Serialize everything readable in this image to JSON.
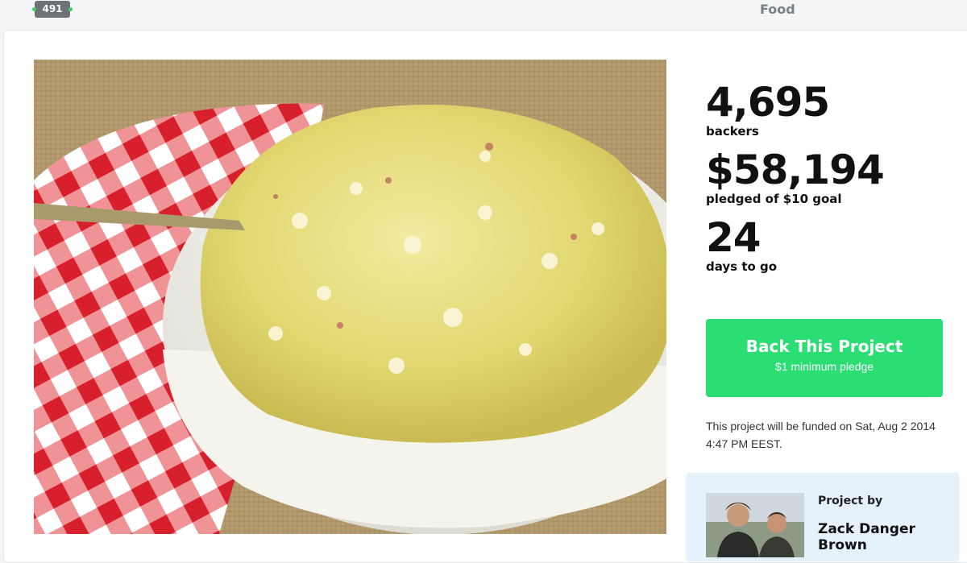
{
  "header": {
    "badge_count": "491",
    "category": "Food"
  },
  "project": {
    "image_alt": "Bowl of potato salad on a red checkered napkin"
  },
  "stats": {
    "backers_count": "4,695",
    "backers_label": "backers",
    "pledged_amount": "$58,194",
    "pledged_label": "pledged of $10 goal",
    "days_count": "24",
    "days_label": "days to go"
  },
  "back_button": {
    "label": "Back This Project",
    "sublabel": "$1 minimum pledge"
  },
  "funding_note": "This project will be funded on Sat, Aug 2 2014 4:47 PM EEST.",
  "creator": {
    "project_by_label": "Project by",
    "name": "Zack Danger Brown"
  },
  "colors": {
    "accent_green": "#2bde73",
    "badge_gray": "#6e7275",
    "creator_panel": "#e6f2fb"
  }
}
